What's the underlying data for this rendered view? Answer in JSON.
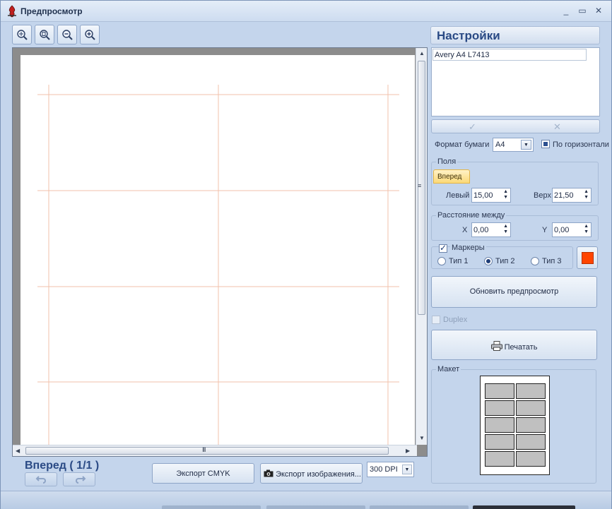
{
  "window": {
    "title": "Предпросмотр",
    "controls": {
      "minimize": "_",
      "maximize": "▭",
      "close": "✕"
    }
  },
  "toolbar": {
    "buttons": [
      {
        "name": "zoom-fit-icon"
      },
      {
        "name": "zoom-page-icon"
      },
      {
        "name": "zoom-out-icon"
      },
      {
        "name": "zoom-in-icon"
      }
    ]
  },
  "preview": {
    "page_label": "Вперед ( 1/1 )",
    "grip": "III",
    "scroll_glyphs": {
      "up": "▲",
      "down": "▼",
      "left": "◀",
      "right": "▶"
    },
    "guide_color": "#f0b79c"
  },
  "bottom": {
    "export_cmyk": "Экспорт CMYK",
    "export_image": "Экспорт изображения...",
    "dpi": "300 DPI",
    "dropdown_glyph": "▼"
  },
  "settings": {
    "header": "Настройки",
    "templates": [
      "Avery A4 L7413"
    ],
    "ok_glyph": "✓",
    "cancel_glyph": "✕",
    "paper_format_label": "Формат бумаги",
    "paper_format_value": "A4",
    "landscape_label": "По горизонтали",
    "margins": {
      "title": "Поля",
      "tab": "Вперед",
      "left_label": "Левый",
      "left_value": "15,00",
      "top_label": "Верх",
      "top_value": "21,50"
    },
    "spacing": {
      "title": "Расстояние между",
      "x_label": "X",
      "x_value": "0,00",
      "y_label": "Y",
      "y_value": "0,00"
    },
    "markers": {
      "label": "Маркеры",
      "checked": true,
      "types": [
        "Тип 1",
        "Тип 2",
        "Тип 3"
      ],
      "selected": "Тип 2",
      "color": "#ff4500"
    },
    "refresh": "Обновить предпросмотр",
    "duplex": "Duplex",
    "print": "Печатать",
    "layout_title": "Макет",
    "layout_rows": 5,
    "layout_cols": 2
  }
}
